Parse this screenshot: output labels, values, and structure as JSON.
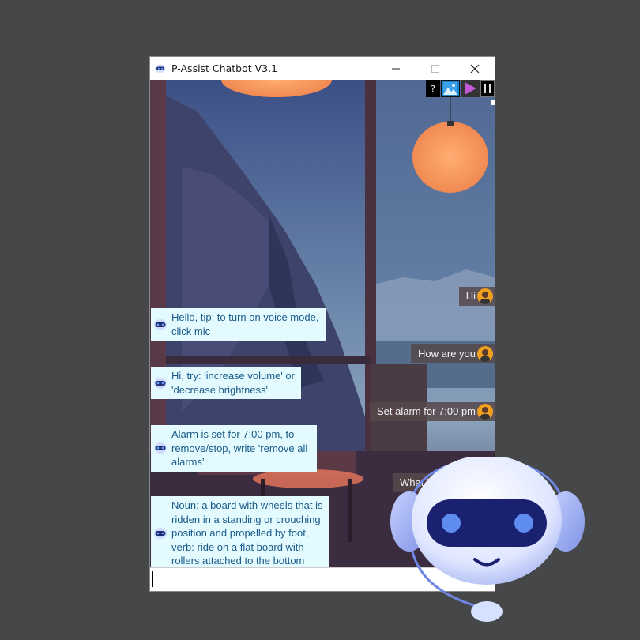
{
  "window": {
    "title": "P-Assist Chatbot V3.1",
    "controls": [
      "minimize",
      "maximize",
      "close"
    ]
  },
  "toolbar": {
    "help_label": "?",
    "buttons": [
      "help-icon",
      "image-icon",
      "play-icon",
      "pause-icon"
    ]
  },
  "messages": [
    {
      "sender": "user",
      "text": "Hi"
    },
    {
      "sender": "bot",
      "lines": [
        "Hello, tip: to turn on voice mode,",
        "click mic"
      ]
    },
    {
      "sender": "user",
      "text": "How are you"
    },
    {
      "sender": "bot",
      "lines": [
        "Hi, try: 'increase volume' or",
        "'decrease brightness'"
      ]
    },
    {
      "sender": "user",
      "text": "Set alarm for 7:00 pm"
    },
    {
      "sender": "bot",
      "lines": [
        "Alarm is set for 7:00 pm, to",
        "remove/stop, write 'remove all",
        "alarms'"
      ]
    },
    {
      "sender": "user",
      "text": "What is sk"
    },
    {
      "sender": "bot",
      "lines": [
        "Noun: a board with wheels that is",
        "ridden in a standing or crouching",
        "position and propelled by foot,",
        "verb: ride on a flat board with",
        "rollers attached to the bottom"
      ]
    }
  ],
  "input": {
    "value": "",
    "placeholder": ""
  },
  "colors": {
    "bot_bubble": "#e3fbff",
    "bot_text": "#1a5a8a",
    "user_bubble": "#56484a",
    "desktop": "#464748"
  }
}
